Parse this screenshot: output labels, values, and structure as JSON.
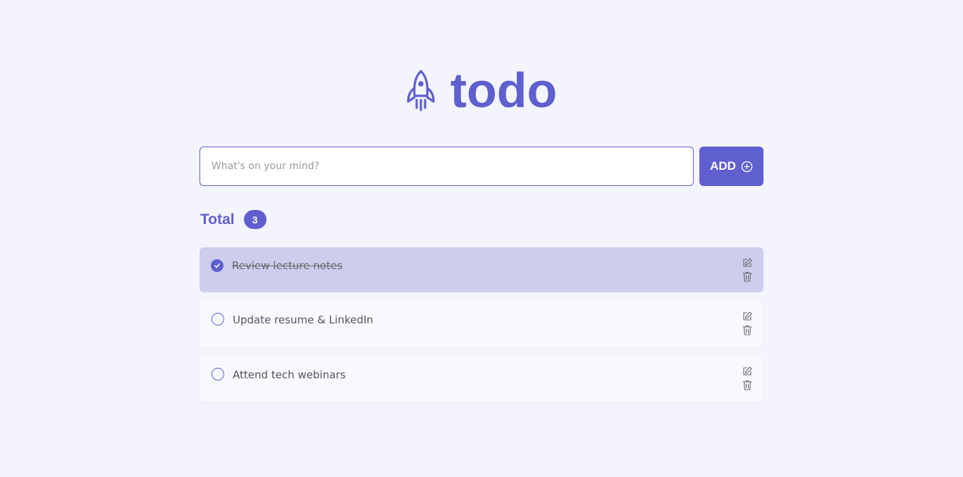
{
  "header": {
    "logo_icon": "rocket-icon",
    "title": "todo"
  },
  "add_form": {
    "placeholder": "What's on your mind?",
    "value": "",
    "add_label": "ADD",
    "add_icon": "plus-circle-icon"
  },
  "summary": {
    "total_label": "Total",
    "total_count": "3"
  },
  "tasks": [
    {
      "text": "Review lecture notes",
      "completed": true
    },
    {
      "text": "Update resume & LinkedIn",
      "completed": false
    },
    {
      "text": "Attend tech webinars",
      "completed": false
    }
  ],
  "icons": {
    "edit": "edit-icon",
    "delete": "trash-icon",
    "check": "checkmark-icon"
  },
  "colors": {
    "accent": "#5f5fcf",
    "background": "#f4f4fd",
    "completed_row": "#cdcdee",
    "row": "#f7f9fd"
  }
}
